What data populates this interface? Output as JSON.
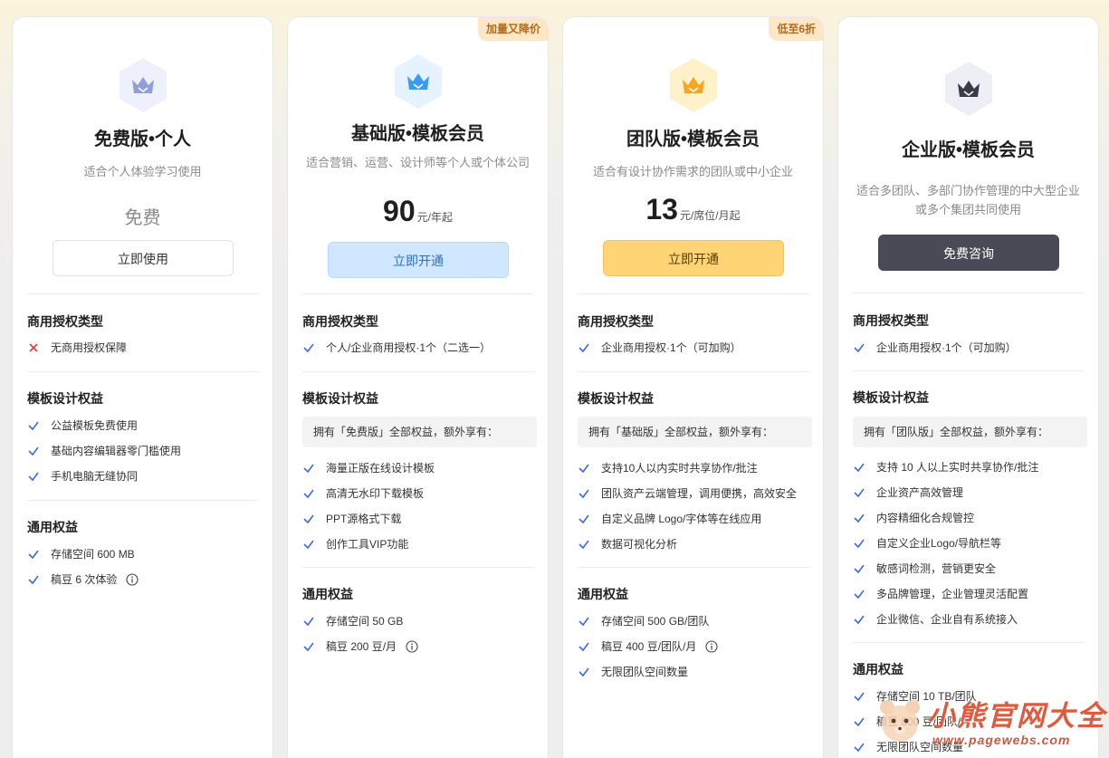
{
  "colors": {
    "check": "#3f6ad8",
    "cross": "#e0372c",
    "badge_bg": "#fde7c7",
    "badge_text": "#b26a1c",
    "free_icon": "#8fa0d9",
    "basic_icon": "#3a9bf0",
    "team_icon": "#f5a623",
    "enterprise_icon": "#3b3b48"
  },
  "plans": [
    {
      "icon": "crown-icon",
      "name": "免费版•个人",
      "desc": "适合个人体验学习使用",
      "price_text": "免费",
      "button": "立即使用",
      "license_title": "商用授权类型",
      "license_items": [
        "无商用授权保障"
      ],
      "template_title": "模板设计权益",
      "template_items": [
        "公益模板免费使用",
        "基础内容编辑器零门槛使用",
        "手机电脑无缝协同"
      ],
      "general_title": "通用权益",
      "general_items": [
        "存储空间 600 MB",
        "稿豆 6 次体验"
      ]
    },
    {
      "badge": "加量又降价",
      "icon": "crown-icon",
      "name": "基础版•模板会员",
      "desc": "适合营销、运营、设计师等个人或个体公司",
      "price_num": "90",
      "price_unit": "元/年起",
      "button": "立即开通",
      "license_title": "商用授权类型",
      "license_items": [
        "个人/企业商用授权·1个（二选一）"
      ],
      "template_title": "模板设计权益",
      "template_note": "拥有「免费版」全部权益，额外享有：",
      "template_items": [
        "海量正版在线设计模板",
        "高清无水印下载模板",
        "PPT源格式下载",
        "创作工具VIP功能"
      ],
      "general_title": "通用权益",
      "general_items": [
        "存储空间 50 GB",
        "稿豆 200 豆/月"
      ]
    },
    {
      "badge": "低至6折",
      "icon": "crown-icon",
      "name": "团队版•模板会员",
      "desc": "适合有设计协作需求的团队或中小企业",
      "price_num": "13",
      "price_unit": "元/席位/月起",
      "button": "立即开通",
      "license_title": "商用授权类型",
      "license_items": [
        "企业商用授权·1个（可加购）"
      ],
      "template_title": "模板设计权益",
      "template_note": "拥有「基础版」全部权益，额外享有：",
      "template_items": [
        "支持10人以内实时共享协作/批注",
        "团队资产云端管理，调用便携，高效安全",
        "自定义品牌 Logo/字体等在线应用",
        "数据可视化分析"
      ],
      "general_title": "通用权益",
      "general_items": [
        "存储空间 500 GB/团队",
        "稿豆 400 豆/团队/月",
        "无限团队空间数量"
      ]
    },
    {
      "icon": "crown-icon",
      "name": "企业版•模板会员",
      "desc": "适合多团队、多部门协作管理的中大型企业或多个集团共同使用",
      "button": "免费咨询",
      "license_title": "商用授权类型",
      "license_items": [
        "企业商用授权·1个（可加购）"
      ],
      "template_title": "模板设计权益",
      "template_note": "拥有「团队版」全部权益，额外享有：",
      "template_items": [
        "支持 10 人以上实时共享协作/批注",
        "企业资产高效管理",
        "内容精细化合规管控",
        "自定义企业Logo/导航栏等",
        "敏感词检测，营销更安全",
        "多品牌管理，企业管理灵活配置",
        "企业微信、企业自有系统接入"
      ],
      "general_title": "通用权益",
      "general_items": [
        "存储空间 10 TB/团队",
        "稿豆 800 豆/团队/月",
        "无限团队空间数量"
      ]
    }
  ],
  "watermark": {
    "title": "小熊官网大全",
    "url": "www.pagewebs.com"
  }
}
